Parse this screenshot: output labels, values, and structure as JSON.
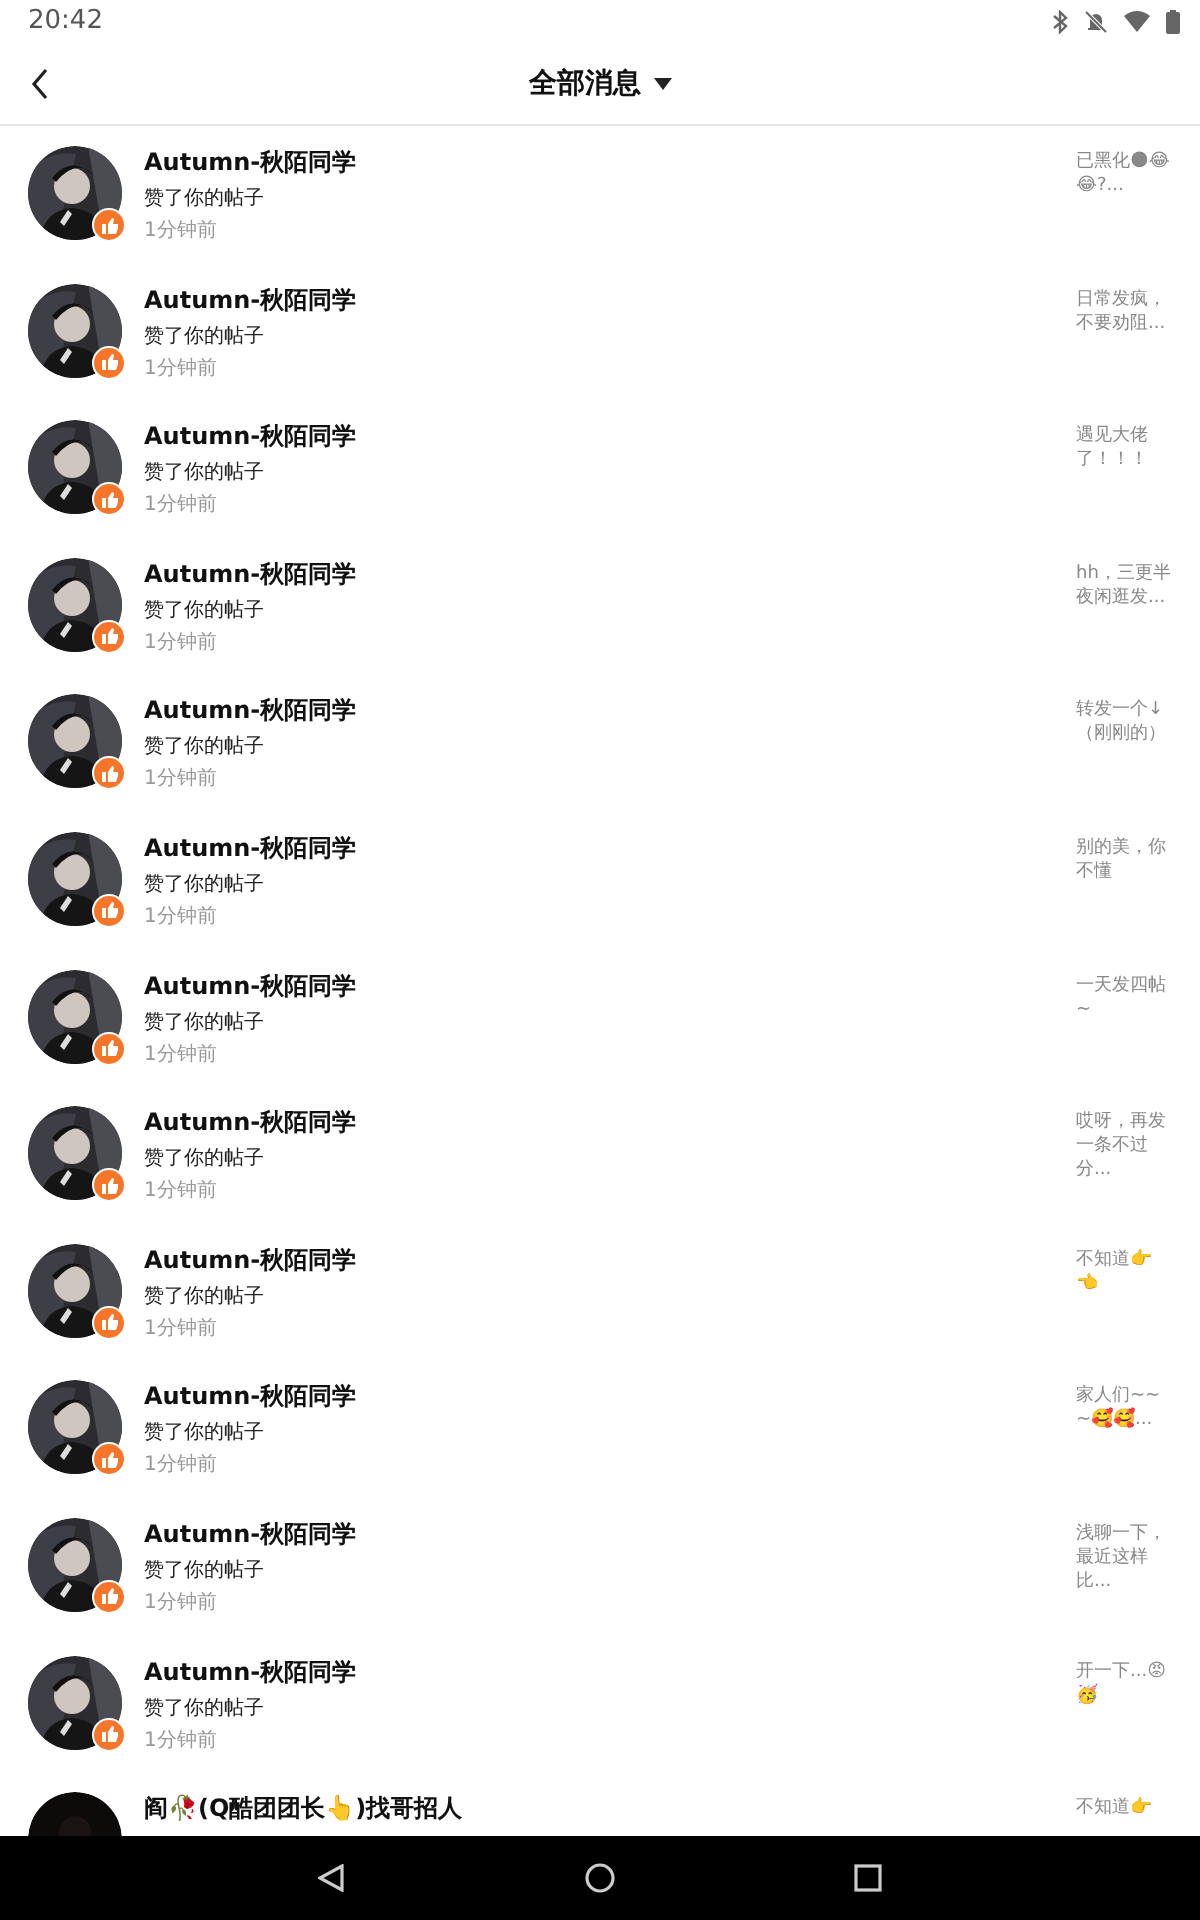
{
  "status_bar": {
    "time": "20:42"
  },
  "header": {
    "title": "全部消息"
  },
  "messages": [
    {
      "name": "Autumn-秋陌同学",
      "action": "赞了你的帖子",
      "time": "1分钟前",
      "preview": "已黑化🌑😂😂?...",
      "badge": true
    },
    {
      "name": "Autumn-秋陌同学",
      "action": "赞了你的帖子",
      "time": "1分钟前",
      "preview": "日常发疯，不要劝阻...",
      "badge": true
    },
    {
      "name": "Autumn-秋陌同学",
      "action": "赞了你的帖子",
      "time": "1分钟前",
      "preview": "遇见大佬了！！！",
      "badge": true
    },
    {
      "name": "Autumn-秋陌同学",
      "action": "赞了你的帖子",
      "time": "1分钟前",
      "preview": "hh，三更半夜闲逛发...",
      "badge": true
    },
    {
      "name": "Autumn-秋陌同学",
      "action": "赞了你的帖子",
      "time": "1分钟前",
      "preview": "转发一个↓（刚刚的）",
      "badge": true
    },
    {
      "name": "Autumn-秋陌同学",
      "action": "赞了你的帖子",
      "time": "1分钟前",
      "preview": "别的美，你不懂",
      "badge": true
    },
    {
      "name": "Autumn-秋陌同学",
      "action": "赞了你的帖子",
      "time": "1分钟前",
      "preview": "一天发四帖~",
      "badge": true
    },
    {
      "name": "Autumn-秋陌同学",
      "action": "赞了你的帖子",
      "time": "1分钟前",
      "preview": "哎呀，再发一条不过分...",
      "badge": true
    },
    {
      "name": "Autumn-秋陌同学",
      "action": "赞了你的帖子",
      "time": "1分钟前",
      "preview": "不知道👉👈",
      "badge": true
    },
    {
      "name": "Autumn-秋陌同学",
      "action": "赞了你的帖子",
      "time": "1分钟前",
      "preview": "家人们~~~🥰🥰...",
      "badge": true
    },
    {
      "name": "Autumn-秋陌同学",
      "action": "赞了你的帖子",
      "time": "1分钟前",
      "preview": "浅聊一下，最近这样比...",
      "badge": true
    },
    {
      "name": "Autumn-秋陌同学",
      "action": "赞了你的帖子",
      "time": "1分钟前",
      "preview": "开一下...😡🥳",
      "badge": true
    },
    {
      "name": "阎🥀(Q酷团团长👆)找哥招人",
      "preview": "不知道👉",
      "badge": false
    }
  ]
}
